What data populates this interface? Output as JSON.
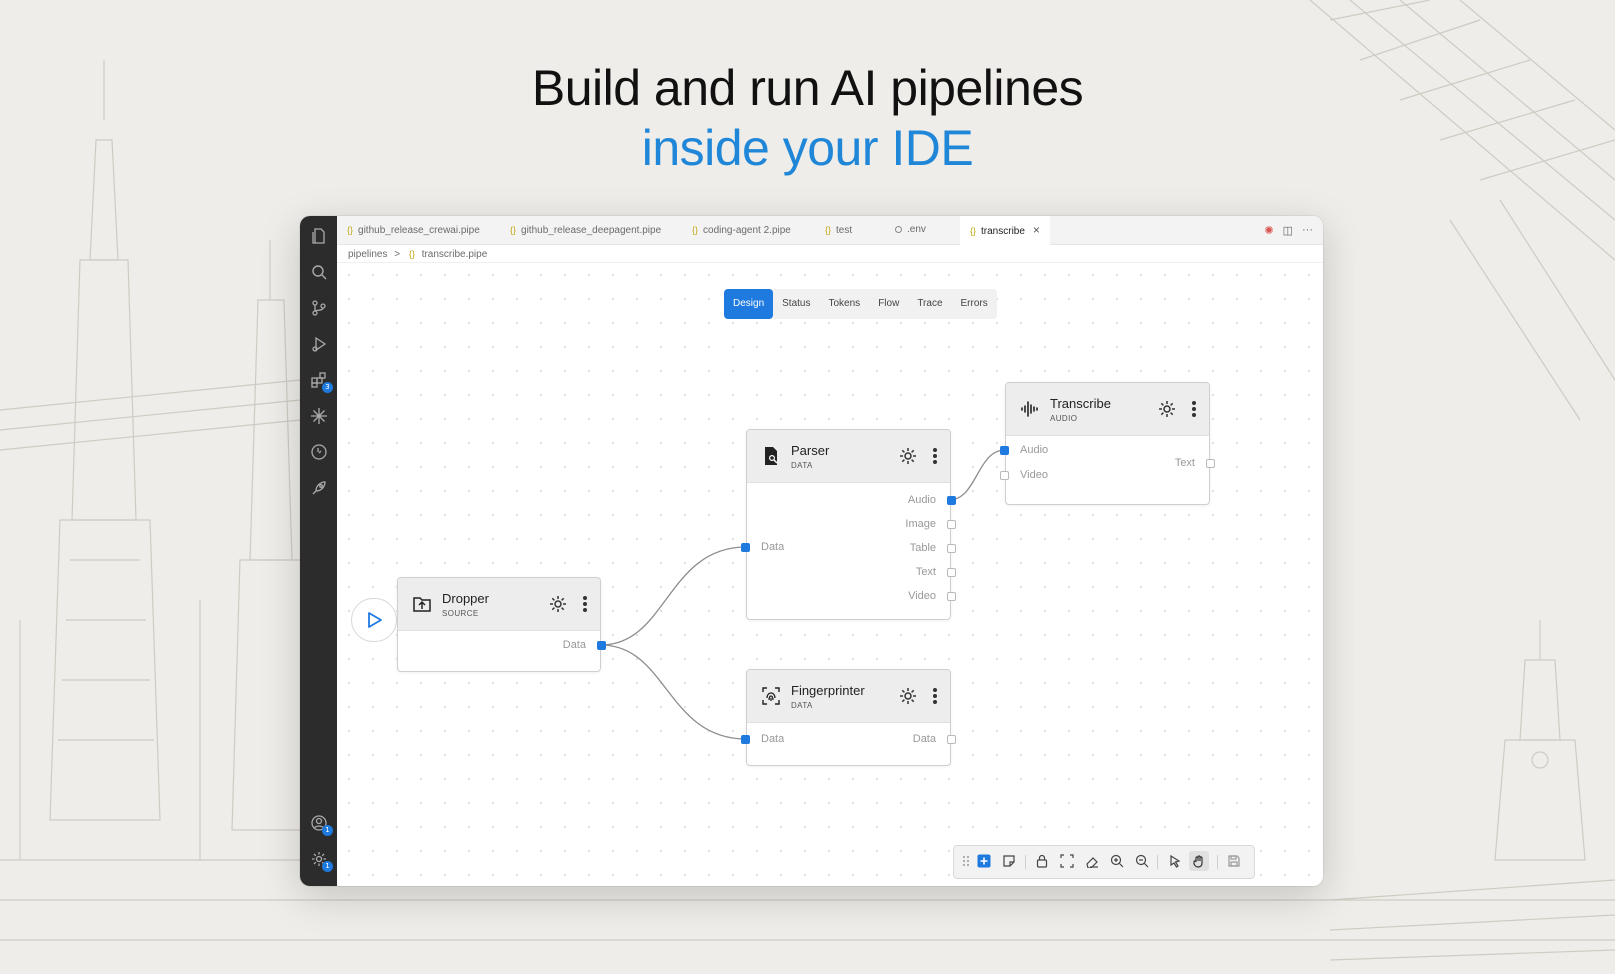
{
  "headline": {
    "line1": "Build and run AI pipelines",
    "line2": "inside your IDE",
    "accent_color": "#1f86d8"
  },
  "editor": {
    "tabs": [
      {
        "label": "github_release_crewai.pipe",
        "icon": "curly-braces-icon"
      },
      {
        "label": "github_release_deepagent.pipe",
        "icon": "curly-braces-icon"
      },
      {
        "label": "coding-agent 2.pipe",
        "icon": "curly-braces-icon"
      },
      {
        "label": "test",
        "icon": "curly-braces-icon"
      },
      {
        "label": ".env",
        "icon": "gear-icon"
      },
      {
        "label": "transcribe",
        "icon": "curly-braces-icon",
        "active": true
      }
    ],
    "breadcrumb": {
      "folder": "pipelines",
      "separator": ">",
      "file": "transcribe.pipe"
    },
    "activity_badges": {
      "extensions": "3",
      "accounts": "1",
      "settings": "1"
    }
  },
  "view_tabs": [
    "Design",
    "Status",
    "Tokens",
    "Flow",
    "Trace",
    "Errors"
  ],
  "active_view_tab": "Design",
  "nodes": {
    "dropper": {
      "title": "Dropper",
      "type": "SOURCE",
      "outputs": [
        "Data"
      ]
    },
    "parser": {
      "title": "Parser",
      "type": "DATA",
      "inputs": [
        "Data"
      ],
      "outputs": [
        "Audio",
        "Image",
        "Table",
        "Text",
        "Video"
      ]
    },
    "transcribe": {
      "title": "Transcribe",
      "type": "AUDIO",
      "inputs": [
        "Audio",
        "Video"
      ],
      "outputs": [
        "Text"
      ]
    },
    "fingerprinter": {
      "title": "Fingerprinter",
      "type": "DATA",
      "inputs": [
        "Data"
      ],
      "outputs": [
        "Data"
      ]
    }
  },
  "colors": {
    "accent": "#1f7ae0",
    "activity_bar": "#2c2c2c",
    "node_header": "#ededed"
  },
  "toolbar_icons": [
    "drag-handle-icon",
    "add-node-icon",
    "note-icon",
    "lock-icon",
    "fit-view-icon",
    "eraser-icon",
    "zoom-in-icon",
    "zoom-out-icon",
    "pointer-icon",
    "hand-icon",
    "save-icon"
  ]
}
